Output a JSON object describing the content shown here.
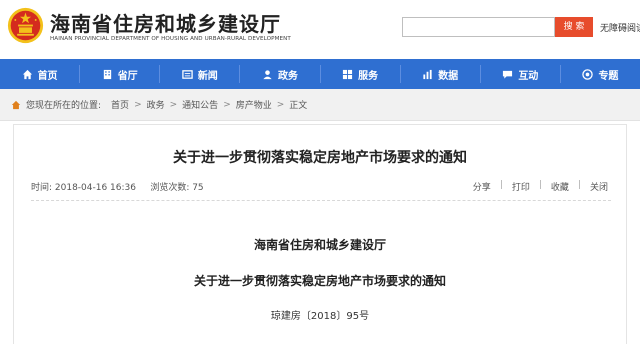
{
  "header": {
    "site_title": "海南省住房和城乡建设厅",
    "site_subtitle": "HAINAN PROVINCIAL DEPARTMENT OF HOUSING AND URBAN-RURAL DEVELOPMENT",
    "search_placeholder": "",
    "search_button": "搜 索",
    "link": "无障碍阅读"
  },
  "nav": {
    "items": [
      {
        "label": "首页",
        "icon": "home-icon"
      },
      {
        "label": "省厅",
        "icon": "building-icon"
      },
      {
        "label": "新闻",
        "icon": "news-icon"
      },
      {
        "label": "政务",
        "icon": "government-icon"
      },
      {
        "label": "服务",
        "icon": "service-icon"
      },
      {
        "label": "数据",
        "icon": "data-icon"
      },
      {
        "label": "互动",
        "icon": "chat-icon"
      },
      {
        "label": "专题",
        "icon": "topic-icon"
      }
    ]
  },
  "breadcrumb": {
    "prefix": "您现在所在的位置:",
    "items": [
      "首页",
      "政务",
      "通知公告",
      "房产物业",
      "正文"
    ],
    "separator": ">"
  },
  "article": {
    "title": "关于进一步贯彻落实稳定房地产市场要求的通知",
    "time_label": "时间: 2018-04-16 16:36",
    "views_label": "浏览次数: 75",
    "tools": [
      "分享",
      "打印",
      "收藏",
      "关闭"
    ],
    "org": "海南省住房和城乡建设厅",
    "doc_title": "关于进一步贯彻落实稳定房地产市场要求的通知",
    "doc_number": "琼建房〔2018〕95号"
  },
  "colors": {
    "nav_bg": "#2f6fd1",
    "search_button": "#e74c2c",
    "emblem_red": "#d42b1e",
    "emblem_gold": "#f3c11b"
  }
}
